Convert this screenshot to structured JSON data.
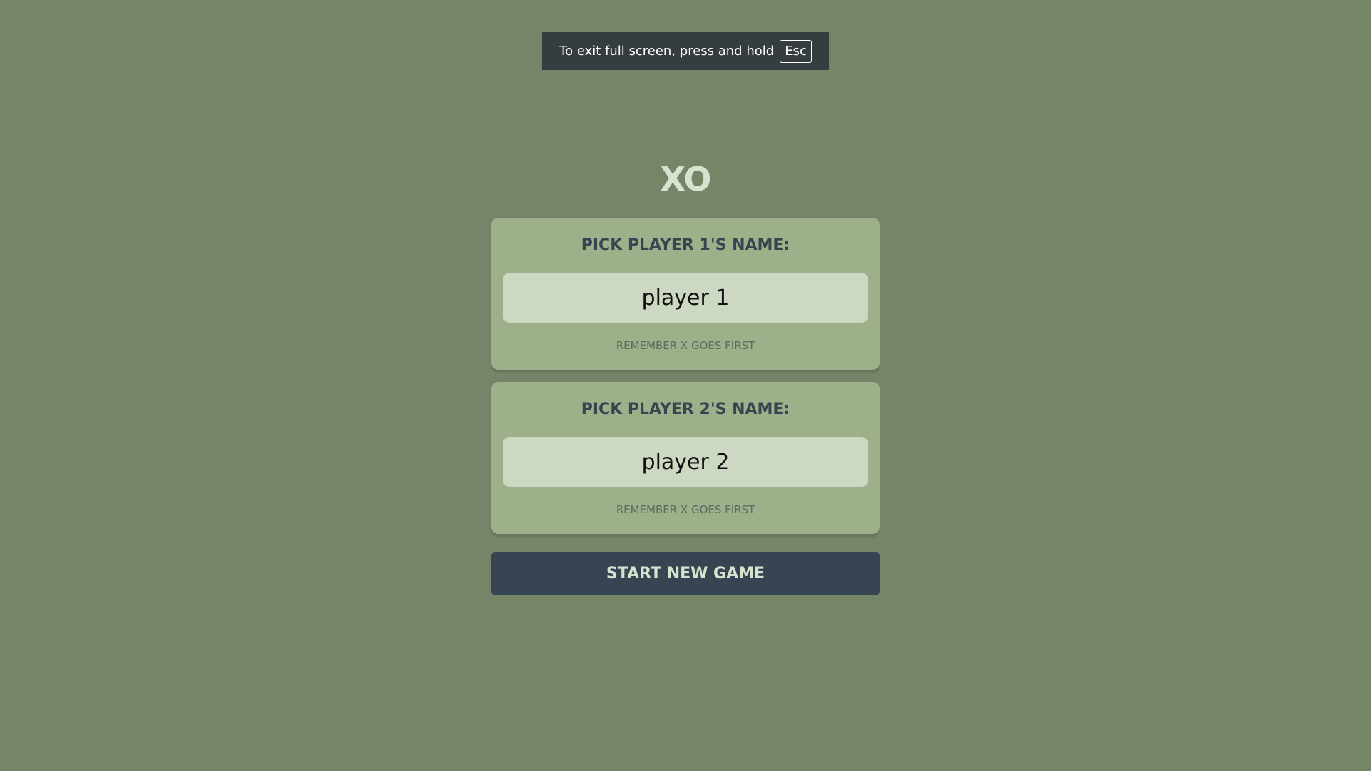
{
  "fullscreen_notice": {
    "text": "To exit full screen, press and hold",
    "key_label": "Esc"
  },
  "app": {
    "title": "XO"
  },
  "players": [
    {
      "heading": "PICK PLAYER 1'S NAME:",
      "name_value": "player 1",
      "hint": "REMEMBER X GOES FIRST"
    },
    {
      "heading": "PICK PLAYER 2'S NAME:",
      "name_value": "player 2",
      "hint": "REMEMBER X GOES FIRST"
    }
  ],
  "start_button_label": "START NEW GAME",
  "colors": {
    "background": "#768467",
    "card": "#9db089",
    "input": "#cdd8c2",
    "dark": "#374553",
    "title": "#d7e2cf"
  }
}
